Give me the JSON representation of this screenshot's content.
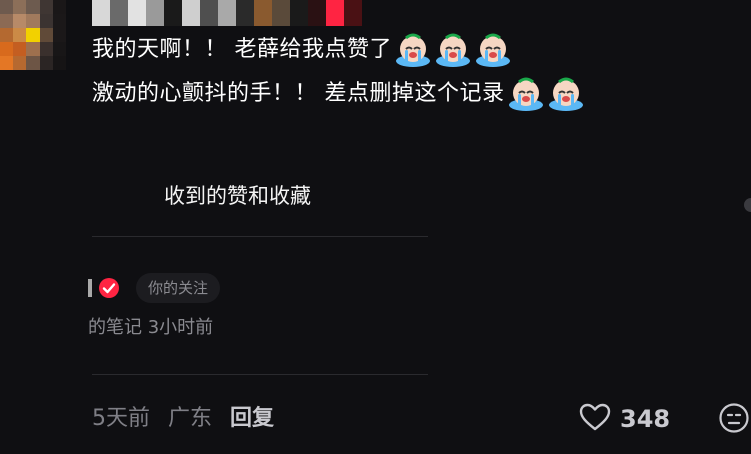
{
  "comment": {
    "line1": "我的天啊！！ 老薛给我点赞了",
    "line2": "激动的心颤抖的手！！ 差点删掉这个记录"
  },
  "card": {
    "title": "收到的赞和收藏",
    "tag": "你的关注",
    "meta": "的笔记  3小时前"
  },
  "footer": {
    "time": "5天前",
    "location": "广东",
    "reply": "回复",
    "likes": "348"
  },
  "icons": {
    "emoji": "crying-face-emoji",
    "verified": "red-check-badge",
    "like": "heart-outline-icon",
    "more": "meh-face-icon"
  },
  "colors": {
    "background": "#0f0f12",
    "accent_red": "#ff2442",
    "text_primary": "#ffffff",
    "text_secondary": "#8a8a90"
  }
}
